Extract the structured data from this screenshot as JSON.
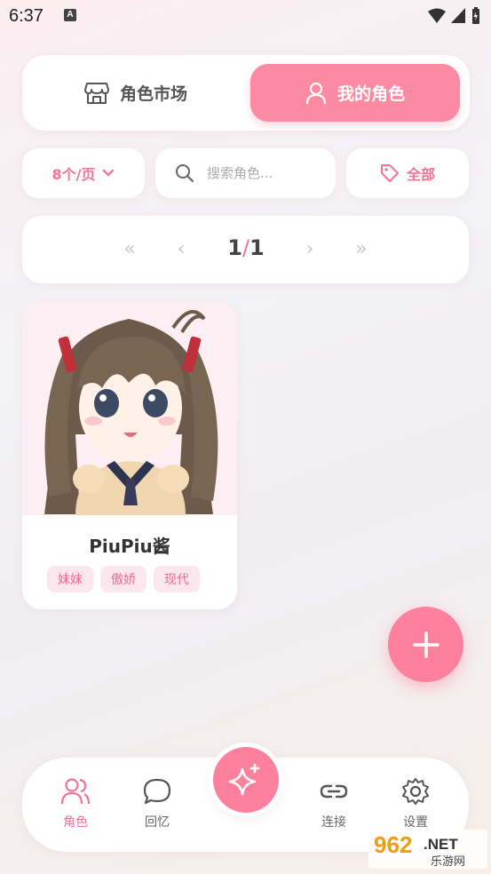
{
  "status": {
    "time": "6:37"
  },
  "tabs": {
    "market": "角色市场",
    "mine": "我的角色"
  },
  "toolbar": {
    "per_page": "8个/页",
    "search_placeholder": "搜索角色...",
    "filter": "全部"
  },
  "pager": {
    "current": "1",
    "separator": "/",
    "total": "1"
  },
  "characters": [
    {
      "name": "PiuPiu酱",
      "tags": [
        "妹妹",
        "傲娇",
        "现代"
      ]
    }
  ],
  "nav": {
    "role": "角色",
    "memory": "回忆",
    "connect": "连接",
    "settings": "设置"
  },
  "watermark": {
    "number": "962",
    "net": ".NET",
    "sub": "乐游网"
  },
  "colors": {
    "accent": "#fd8aa3",
    "accent_text": "#f47394",
    "tag_bg": "#fde7ee"
  }
}
